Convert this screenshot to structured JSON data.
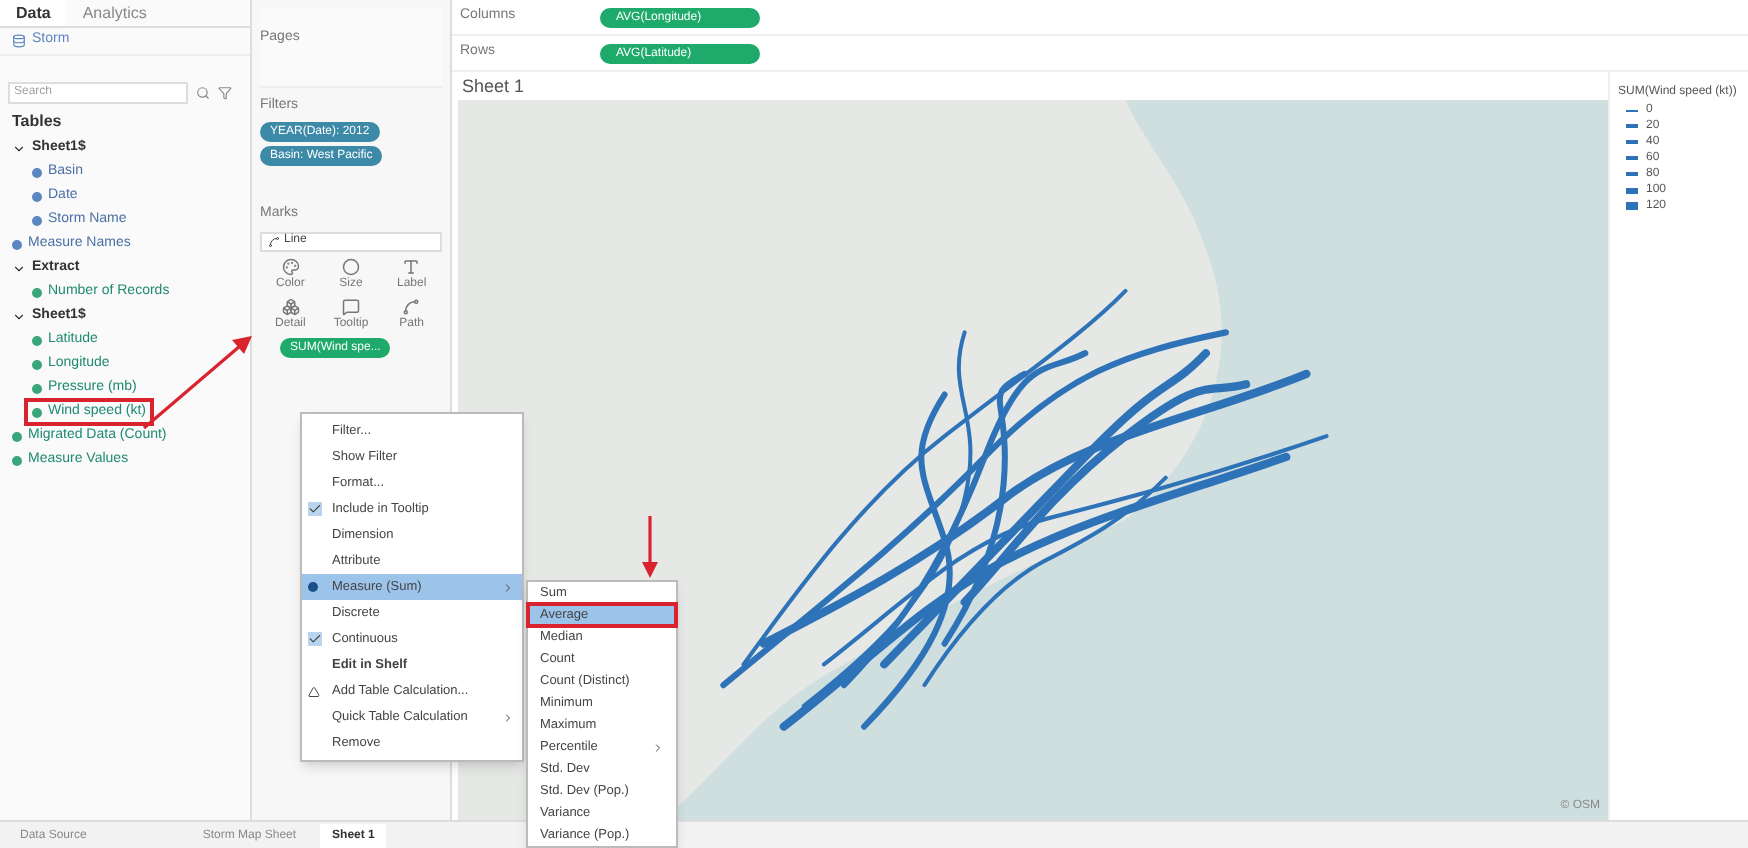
{
  "data_pane": {
    "tabs": [
      {
        "label": "Data",
        "selected": true
      },
      {
        "label": "Analytics",
        "selected": false
      }
    ],
    "source": "Storm",
    "search": {
      "placeholder": "Search"
    },
    "section": "Tables",
    "fields": [
      {
        "label": "Sheet1$",
        "kind": "table",
        "annotated": false,
        "children": [
          {
            "label": "Basin",
            "kind": "dimension",
            "annotated": false
          },
          {
            "label": "Date",
            "kind": "dimension",
            "annotated": false
          },
          {
            "label": "Storm Name",
            "kind": "dimension",
            "annotated": false
          }
        ]
      },
      {
        "label": "Measure Names",
        "kind": "dimension",
        "annotated": false
      },
      {
        "label": "Extract",
        "kind": "table",
        "annotated": false,
        "children": [
          {
            "label": "Number of Records",
            "kind": "measure",
            "annotated": false
          }
        ]
      },
      {
        "label": "Sheet1$",
        "kind": "table",
        "annotated": false,
        "children": [
          {
            "label": "Latitude",
            "kind": "measure",
            "annotated": false
          },
          {
            "label": "Longitude",
            "kind": "measure",
            "annotated": false
          },
          {
            "label": "Pressure (mb)",
            "kind": "measure",
            "annotated": false
          },
          {
            "label": "Wind speed (kt)",
            "kind": "measure",
            "annotated": true
          }
        ]
      },
      {
        "label": "Migrated Data (Count)",
        "kind": "measure",
        "annotated": false
      },
      {
        "label": "Measure Values",
        "kind": "measure",
        "annotated": false
      }
    ]
  },
  "pages": {
    "title": "Pages"
  },
  "filters": {
    "title": "Filters",
    "pills": [
      "YEAR(Date): 2012",
      "Basin: West Pacific"
    ]
  },
  "marks": {
    "title": "Marks",
    "type": "Line",
    "buttons": [
      {
        "label": "Color",
        "kind": "color"
      },
      {
        "label": "Size",
        "kind": "size"
      },
      {
        "label": "Label",
        "kind": "label"
      },
      {
        "label": "Detail",
        "kind": "detail"
      },
      {
        "label": "Tooltip",
        "kind": "tooltip"
      },
      {
        "label": "Path",
        "kind": "path"
      }
    ],
    "pill": "SUM(Wind spe..."
  },
  "shelves": [
    {
      "label": "Columns",
      "pill": "AVG(Longitude)"
    },
    {
      "label": "Rows",
      "pill": "AVG(Latitude)"
    }
  ],
  "sheet_title": "Sheet 1",
  "map_footer": "© OSM",
  "legend": {
    "title": "SUM(Wind speed (kt))",
    "values": [
      "0",
      "20",
      "40",
      "60",
      "80",
      "100",
      "120"
    ]
  },
  "context_menu": [
    {
      "label": "Filter...",
      "kind": "plain",
      "checked": false,
      "selected": false
    },
    {
      "label": "Show Filter",
      "kind": "plain",
      "checked": false,
      "selected": false
    },
    {
      "label": "Format...",
      "kind": "plain",
      "checked": false,
      "selected": false
    },
    {
      "label": "Include in Tooltip",
      "kind": "check",
      "checked": true,
      "selected": false
    },
    {
      "label": "Dimension",
      "kind": "plain",
      "checked": false,
      "selected": false
    },
    {
      "label": "Attribute",
      "kind": "plain",
      "checked": false,
      "selected": false
    },
    {
      "label": "Measure (Sum)",
      "kind": "submenu",
      "checked": true,
      "selected": true
    },
    {
      "label": "Discrete",
      "kind": "plain",
      "checked": false,
      "selected": false
    },
    {
      "label": "Continuous",
      "kind": "check",
      "checked": true,
      "selected": false
    },
    {
      "label": "Edit in Shelf",
      "kind": "bold",
      "checked": false,
      "selected": false
    },
    {
      "label": "Add Table Calculation...",
      "kind": "calc",
      "checked": false,
      "selected": false
    },
    {
      "label": "Quick Table Calculation",
      "kind": "submenu",
      "checked": false,
      "selected": false
    },
    {
      "label": "Remove",
      "kind": "plain",
      "checked": false,
      "selected": false
    }
  ],
  "submenu": [
    {
      "label": "Sum",
      "kind": "plain",
      "selected": false,
      "annotated": false
    },
    {
      "label": "Average",
      "kind": "plain",
      "selected": true,
      "annotated": true
    },
    {
      "label": "Median",
      "kind": "plain",
      "selected": false,
      "annotated": false
    },
    {
      "label": "Count",
      "kind": "plain",
      "selected": false,
      "annotated": false
    },
    {
      "label": "Count (Distinct)",
      "kind": "plain",
      "selected": false,
      "annotated": false
    },
    {
      "label": "Minimum",
      "kind": "plain",
      "selected": false,
      "annotated": false
    },
    {
      "label": "Maximum",
      "kind": "plain",
      "selected": false,
      "annotated": false
    },
    {
      "label": "Percentile",
      "kind": "submenu",
      "selected": false,
      "annotated": false
    },
    {
      "label": "Std. Dev",
      "kind": "plain",
      "selected": false,
      "annotated": false
    },
    {
      "label": "Std. Dev (Pop.)",
      "kind": "plain",
      "selected": false,
      "annotated": false
    },
    {
      "label": "Variance",
      "kind": "plain",
      "selected": false,
      "annotated": false
    },
    {
      "label": "Variance (Pop.)",
      "kind": "plain",
      "selected": false,
      "annotated": false
    }
  ],
  "sheet_tabs": [
    {
      "label": "Data Source",
      "kind": "source",
      "selected": false
    },
    {
      "label": "Storm Map Sheet",
      "kind": "sheet",
      "selected": false
    },
    {
      "label": "Sheet 1",
      "kind": "sheet",
      "selected": true
    }
  ]
}
